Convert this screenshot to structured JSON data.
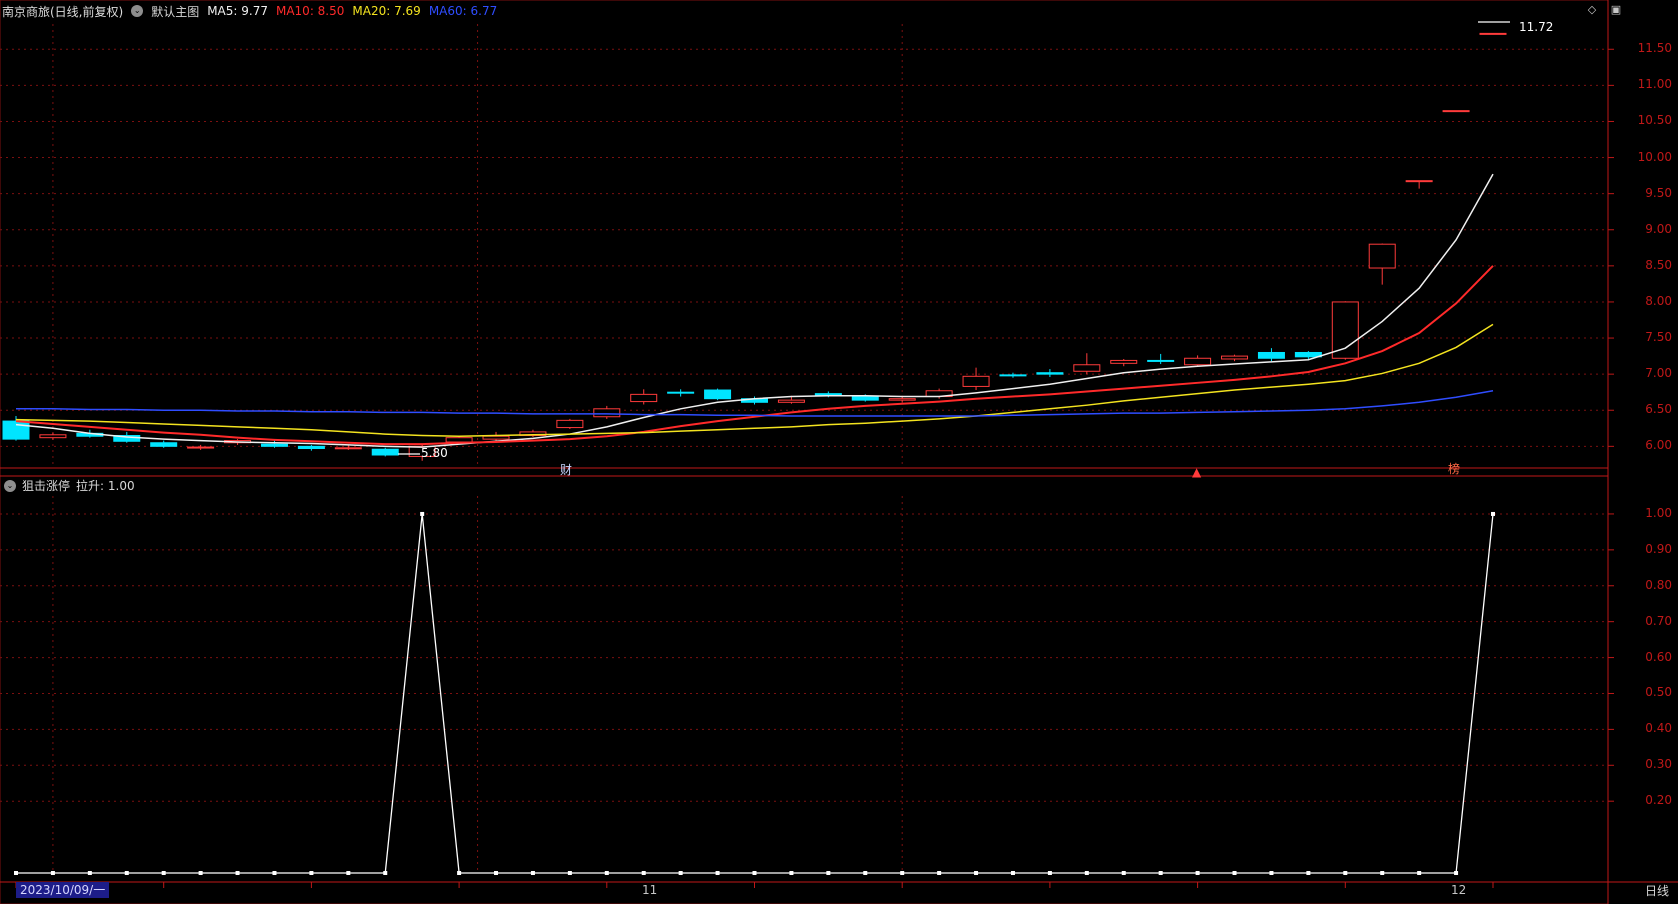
{
  "header": {
    "title": "南京商旅(日线,前复权)",
    "main_chart": "默认主图",
    "ma5": "MA5: 9.77",
    "ma10": "MA10: 8.50",
    "ma20": "MA20: 7.69",
    "ma60": "MA60: 6.77"
  },
  "top_icons": {
    "diamond": "◇",
    "window": "▣"
  },
  "price_axis": [
    "11.50",
    "11.00",
    "10.50",
    "10.00",
    "9.50",
    "9.00",
    "8.50",
    "8.00",
    "7.50",
    "7.00",
    "6.50",
    "6.00"
  ],
  "indicator_axis": [
    "1.00",
    "0.90",
    "0.80",
    "0.70",
    "0.60",
    "0.50",
    "0.40",
    "0.30",
    "0.20"
  ],
  "annotations": {
    "high": "11.72",
    "low": "5.80",
    "finance_marker": "财",
    "rank_marker": "榜"
  },
  "indicator": {
    "name": "狙击涨停",
    "label": "拉升: 1.00"
  },
  "time_axis": {
    "date_tag": "2023/10/09/一",
    "month_nov": "11",
    "month_dec": "12",
    "period": "日线"
  },
  "colors": {
    "background": "#000000",
    "grid": "#7c1010",
    "axis_red": "#c01818",
    "up_red": "#ff3b3b",
    "down_cyan": "#00e5ff",
    "ma5": "#f0f0f0",
    "ma10": "#ff2a2a",
    "ma20": "#f3e31f",
    "ma60": "#2f4dff",
    "indicator": "#ffffff"
  },
  "chart_data": {
    "type": "line",
    "price_candles": [
      {
        "o": 6.35,
        "h": 6.42,
        "l": 6.08,
        "c": 6.1,
        "dir": "down"
      },
      {
        "o": 6.12,
        "h": 6.19,
        "l": 6.09,
        "c": 6.16,
        "dir": "up"
      },
      {
        "o": 6.18,
        "h": 6.23,
        "l": 6.12,
        "c": 6.14,
        "dir": "down"
      },
      {
        "o": 6.15,
        "h": 6.2,
        "l": 6.05,
        "c": 6.07,
        "dir": "down"
      },
      {
        "o": 6.05,
        "h": 6.08,
        "l": 5.98,
        "c": 6.0,
        "dir": "down"
      },
      {
        "o": 5.98,
        "h": 6.02,
        "l": 5.95,
        "c": 5.99,
        "dir": "up"
      },
      {
        "o": 6.05,
        "h": 6.1,
        "l": 6.02,
        "c": 6.08,
        "dir": "up"
      },
      {
        "o": 6.03,
        "h": 6.08,
        "l": 5.98,
        "c": 6.0,
        "dir": "down"
      },
      {
        "o": 6.0,
        "h": 6.02,
        "l": 5.94,
        "c": 5.97,
        "dir": "down"
      },
      {
        "o": 5.98,
        "h": 6.02,
        "l": 5.95,
        "c": 5.98,
        "dir": "up"
      },
      {
        "o": 5.96,
        "h": 5.98,
        "l": 5.86,
        "c": 5.88,
        "dir": "down"
      },
      {
        "o": 5.86,
        "h": 6.02,
        "l": 5.8,
        "c": 6.0,
        "dir": "up"
      },
      {
        "o": 6.06,
        "h": 6.15,
        "l": 6.03,
        "c": 6.12,
        "dir": "up"
      },
      {
        "o": 6.1,
        "h": 6.2,
        "l": 6.08,
        "c": 6.14,
        "dir": "up"
      },
      {
        "o": 6.15,
        "h": 6.23,
        "l": 6.13,
        "c": 6.2,
        "dir": "up"
      },
      {
        "o": 6.26,
        "h": 6.38,
        "l": 6.24,
        "c": 6.36,
        "dir": "up"
      },
      {
        "o": 6.41,
        "h": 6.56,
        "l": 6.38,
        "c": 6.52,
        "dir": "up"
      },
      {
        "o": 6.62,
        "h": 6.79,
        "l": 6.58,
        "c": 6.72,
        "dir": "up"
      },
      {
        "o": 6.74,
        "h": 6.79,
        "l": 6.69,
        "c": 6.75,
        "dir": "down"
      },
      {
        "o": 6.78,
        "h": 6.8,
        "l": 6.64,
        "c": 6.66,
        "dir": "down"
      },
      {
        "o": 6.66,
        "h": 6.69,
        "l": 6.58,
        "c": 6.61,
        "dir": "down"
      },
      {
        "o": 6.61,
        "h": 6.7,
        "l": 6.59,
        "c": 6.64,
        "dir": "up"
      },
      {
        "o": 6.7,
        "h": 6.76,
        "l": 6.68,
        "c": 6.73,
        "dir": "down"
      },
      {
        "o": 6.69,
        "h": 6.72,
        "l": 6.62,
        "c": 6.64,
        "dir": "down"
      },
      {
        "o": 6.64,
        "h": 6.7,
        "l": 6.61,
        "c": 6.66,
        "dir": "up"
      },
      {
        "o": 6.69,
        "h": 6.8,
        "l": 6.66,
        "c": 6.77,
        "dir": "up"
      },
      {
        "o": 6.83,
        "h": 7.09,
        "l": 6.78,
        "c": 6.97,
        "dir": "up"
      },
      {
        "o": 6.99,
        "h": 7.02,
        "l": 6.95,
        "c": 6.98,
        "dir": "down"
      },
      {
        "o": 7.02,
        "h": 7.07,
        "l": 6.96,
        "c": 7.0,
        "dir": "down"
      },
      {
        "o": 7.04,
        "h": 7.29,
        "l": 7.0,
        "c": 7.13,
        "dir": "up"
      },
      {
        "o": 7.15,
        "h": 7.21,
        "l": 7.11,
        "c": 7.19,
        "dir": "up"
      },
      {
        "o": 7.18,
        "h": 7.28,
        "l": 7.14,
        "c": 7.19,
        "dir": "down"
      },
      {
        "o": 7.13,
        "h": 7.26,
        "l": 7.1,
        "c": 7.22,
        "dir": "up"
      },
      {
        "o": 7.21,
        "h": 7.27,
        "l": 7.18,
        "c": 7.25,
        "dir": "up"
      },
      {
        "o": 7.3,
        "h": 7.36,
        "l": 7.18,
        "c": 7.22,
        "dir": "down"
      },
      {
        "o": 7.3,
        "h": 7.32,
        "l": 7.19,
        "c": 7.24,
        "dir": "down"
      },
      {
        "o": 7.22,
        "h": 8.01,
        "l": 7.2,
        "c": 8.0,
        "dir": "up"
      },
      {
        "o": 8.47,
        "h": 8.81,
        "l": 8.24,
        "c": 8.8,
        "dir": "up"
      },
      {
        "o": 9.68,
        "h": 9.68,
        "l": 9.57,
        "c": 9.68,
        "dir": "up"
      },
      {
        "o": 10.65,
        "h": 10.65,
        "l": 10.65,
        "c": 10.65,
        "dir": "up"
      },
      {
        "o": 11.72,
        "h": 11.72,
        "l": 11.72,
        "c": 11.72,
        "dir": "up"
      }
    ],
    "ma_series": [
      {
        "name": "MA5",
        "color": "#f0f0f0",
        "values": [
          6.3,
          6.25,
          6.18,
          6.13,
          6.1,
          6.08,
          6.06,
          6.05,
          6.04,
          6.02,
          6.0,
          5.99,
          6.03,
          6.07,
          6.11,
          6.17,
          6.27,
          6.4,
          6.52,
          6.61,
          6.66,
          6.69,
          6.7,
          6.7,
          6.69,
          6.69,
          6.74,
          6.8,
          6.86,
          6.94,
          7.02,
          7.07,
          7.11,
          7.14,
          7.17,
          7.2,
          7.36,
          7.73,
          8.19,
          8.86,
          9.77
        ]
      },
      {
        "name": "MA10",
        "color": "#ff2a2a",
        "values": [
          6.35,
          6.31,
          6.27,
          6.23,
          6.19,
          6.16,
          6.12,
          6.09,
          6.07,
          6.05,
          6.03,
          6.03,
          6.05,
          6.06,
          6.08,
          6.1,
          6.14,
          6.2,
          6.28,
          6.35,
          6.41,
          6.47,
          6.52,
          6.56,
          6.59,
          6.62,
          6.66,
          6.69,
          6.72,
          6.76,
          6.8,
          6.84,
          6.88,
          6.92,
          6.97,
          7.03,
          7.15,
          7.32,
          7.57,
          7.98,
          8.5
        ]
      },
      {
        "name": "MA20",
        "color": "#f3e31f",
        "values": [
          6.37,
          6.36,
          6.35,
          6.33,
          6.31,
          6.29,
          6.27,
          6.25,
          6.23,
          6.2,
          6.17,
          6.15,
          6.14,
          6.15,
          6.16,
          6.17,
          6.18,
          6.19,
          6.21,
          6.23,
          6.25,
          6.27,
          6.3,
          6.32,
          6.35,
          6.38,
          6.42,
          6.47,
          6.52,
          6.57,
          6.63,
          6.68,
          6.73,
          6.78,
          6.82,
          6.86,
          6.91,
          7.01,
          7.15,
          7.37,
          7.69
        ]
      },
      {
        "name": "MA60",
        "color": "#2f4dff",
        "values": [
          6.52,
          6.52,
          6.51,
          6.51,
          6.5,
          6.5,
          6.49,
          6.49,
          6.48,
          6.48,
          6.47,
          6.47,
          6.46,
          6.46,
          6.45,
          6.45,
          6.45,
          6.44,
          6.44,
          6.43,
          6.43,
          6.42,
          6.42,
          6.42,
          6.42,
          6.42,
          6.42,
          6.43,
          6.44,
          6.45,
          6.46,
          6.46,
          6.47,
          6.48,
          6.49,
          6.5,
          6.52,
          6.56,
          6.61,
          6.68,
          6.77
        ]
      }
    ],
    "indicator_series": [
      {
        "name": "拉升",
        "values": [
          0,
          0,
          0,
          0,
          0,
          0,
          0,
          0,
          0,
          0,
          0,
          1,
          0,
          0,
          0,
          0,
          0,
          0,
          0,
          0,
          0,
          0,
          0,
          0,
          0,
          0,
          0,
          0,
          0,
          0,
          0,
          0,
          0,
          0,
          0,
          0,
          0,
          0,
          0,
          0,
          1
        ]
      }
    ],
    "price_ylim": [
      5.7,
      11.85
    ],
    "indicator_ylim": [
      0,
      1.05
    ],
    "grid": true
  }
}
